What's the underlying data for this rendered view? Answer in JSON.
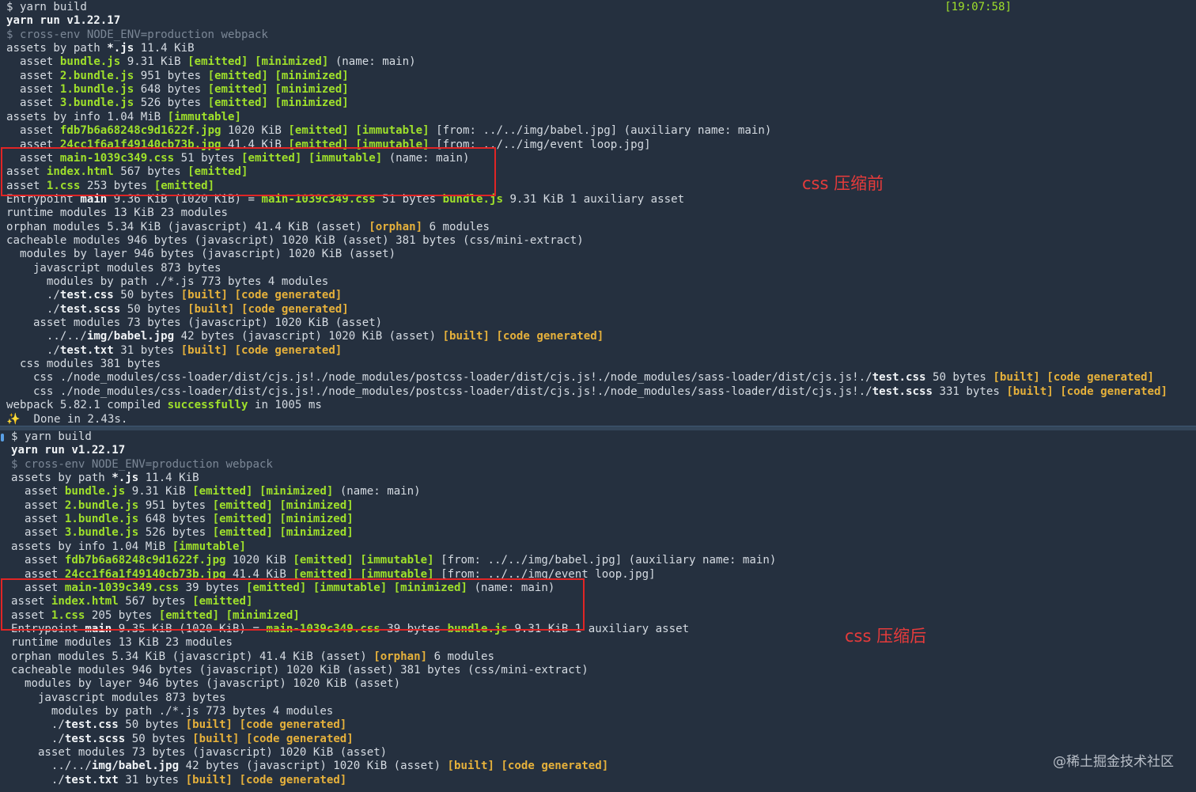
{
  "top": {
    "time": "[19:07:58]",
    "annotation": "css 压缩前",
    "lines": [
      [
        {
          "t": "$ yarn build"
        }
      ],
      [
        {
          "t": "yarn run v1.22.17",
          "s": "b"
        }
      ],
      [
        {
          "t": "$ cross-env NODE_ENV=production webpack",
          "s": "dim"
        }
      ],
      [
        {
          "t": "assets by path "
        },
        {
          "t": "*.js",
          "s": "b"
        },
        {
          "t": " 11.4 KiB"
        }
      ],
      [
        {
          "t": "  asset "
        },
        {
          "t": "bundle.js",
          "s": "g"
        },
        {
          "t": " 9.31 KiB "
        },
        {
          "t": "[emitted] [minimized]",
          "s": "g"
        },
        {
          "t": " (name: main)"
        }
      ],
      [
        {
          "t": "  asset "
        },
        {
          "t": "2.bundle.js",
          "s": "g"
        },
        {
          "t": " 951 bytes "
        },
        {
          "t": "[emitted] [minimized]",
          "s": "g"
        }
      ],
      [
        {
          "t": "  asset "
        },
        {
          "t": "1.bundle.js",
          "s": "g"
        },
        {
          "t": " 648 bytes "
        },
        {
          "t": "[emitted] [minimized]",
          "s": "g"
        }
      ],
      [
        {
          "t": "  asset "
        },
        {
          "t": "3.bundle.js",
          "s": "g"
        },
        {
          "t": " 526 bytes "
        },
        {
          "t": "[emitted] [minimized]",
          "s": "g"
        }
      ],
      [
        {
          "t": "assets by info 1.04 MiB "
        },
        {
          "t": "[immutable]",
          "s": "g"
        }
      ],
      [
        {
          "t": "  asset "
        },
        {
          "t": "fdb7b6a68248c9d1622f.jpg",
          "s": "g"
        },
        {
          "t": " 1020 KiB "
        },
        {
          "t": "[emitted] [immutable]",
          "s": "g"
        },
        {
          "t": " [from: ../../img/babel.jpg] (auxiliary name: main)"
        }
      ],
      [
        {
          "t": "  asset "
        },
        {
          "t": "24cc1f6a1f49140cb73b.jpg",
          "s": "g"
        },
        {
          "t": " 41.4 KiB "
        },
        {
          "t": "[emitted] [immutable]",
          "s": "g"
        },
        {
          "t": " [from: ../../img/event loop.jpg]"
        }
      ],
      [
        {
          "t": "  asset "
        },
        {
          "t": "main-1039c349.css",
          "s": "g"
        },
        {
          "t": " 51 bytes "
        },
        {
          "t": "[emitted] [immutable]",
          "s": "g"
        },
        {
          "t": " (name: main)"
        }
      ],
      [
        {
          "t": "asset "
        },
        {
          "t": "index.html",
          "s": "g"
        },
        {
          "t": " 567 bytes "
        },
        {
          "t": "[emitted]",
          "s": "g"
        }
      ],
      [
        {
          "t": "asset "
        },
        {
          "t": "1.css",
          "s": "g"
        },
        {
          "t": " 253 bytes "
        },
        {
          "t": "[emitted]",
          "s": "g"
        }
      ],
      [
        {
          "t": "Entrypoint "
        },
        {
          "t": "main",
          "s": "b"
        },
        {
          "t": " 9.36 KiB (1020 KiB) = "
        },
        {
          "t": "main-1039c349.css",
          "s": "g"
        },
        {
          "t": " 51 bytes "
        },
        {
          "t": "bundle.js",
          "s": "g"
        },
        {
          "t": " 9.31 KiB 1 auxiliary asset"
        }
      ],
      [
        {
          "t": "runtime modules 13 KiB 23 modules"
        }
      ],
      [
        {
          "t": "orphan modules 5.34 KiB (javascript) 41.4 KiB (asset) "
        },
        {
          "t": "[orphan]",
          "s": "y"
        },
        {
          "t": " 6 modules"
        }
      ],
      [
        {
          "t": "cacheable modules 946 bytes (javascript) 1020 KiB (asset) 381 bytes (css/mini-extract)"
        }
      ],
      [
        {
          "t": "  modules by layer 946 bytes (javascript) 1020 KiB (asset)"
        }
      ],
      [
        {
          "t": "    javascript modules 873 bytes"
        }
      ],
      [
        {
          "t": "      modules by path ./*.js 773 bytes 4 modules"
        }
      ],
      [
        {
          "t": "      ./"
        },
        {
          "t": "test.css",
          "s": "b"
        },
        {
          "t": " 50 bytes "
        },
        {
          "t": "[built] [code generated]",
          "s": "y"
        }
      ],
      [
        {
          "t": "      ./"
        },
        {
          "t": "test.scss",
          "s": "b"
        },
        {
          "t": " 50 bytes "
        },
        {
          "t": "[built] [code generated]",
          "s": "y"
        }
      ],
      [
        {
          "t": "    asset modules 73 bytes (javascript) 1020 KiB (asset)"
        }
      ],
      [
        {
          "t": "      ../../"
        },
        {
          "t": "img/babel.jpg",
          "s": "b"
        },
        {
          "t": " 42 bytes (javascript) 1020 KiB (asset) "
        },
        {
          "t": "[built] [code generated]",
          "s": "y"
        }
      ],
      [
        {
          "t": "      ./"
        },
        {
          "t": "test.txt",
          "s": "b"
        },
        {
          "t": " 31 bytes "
        },
        {
          "t": "[built] [code generated]",
          "s": "y"
        }
      ],
      [
        {
          "t": "  css modules 381 bytes"
        }
      ],
      [
        {
          "t": "    css ./node_modules/css-loader/dist/cjs.js!./node_modules/postcss-loader/dist/cjs.js!./node_modules/sass-loader/dist/cjs.js!./"
        },
        {
          "t": "test.css",
          "s": "b"
        },
        {
          "t": " 50 bytes "
        },
        {
          "t": "[built] [code generated]",
          "s": "y"
        }
      ],
      [
        {
          "t": "    css ./node_modules/css-loader/dist/cjs.js!./node_modules/postcss-loader/dist/cjs.js!./node_modules/sass-loader/dist/cjs.js!./"
        },
        {
          "t": "test.scss",
          "s": "b"
        },
        {
          "t": " 331 bytes "
        },
        {
          "t": "[built] [code generated]",
          "s": "y"
        }
      ],
      [
        {
          "t": "webpack 5.82.1 compiled "
        },
        {
          "t": "successfully",
          "s": "g"
        },
        {
          "t": " in 1005 ms"
        }
      ],
      [
        {
          "t": "✨",
          "s": "spark"
        },
        {
          "t": "  Done in 2.43s."
        }
      ]
    ]
  },
  "bottom": {
    "annotation": "css 压缩后",
    "lines": [
      [
        {
          "t": "$ yarn build"
        }
      ],
      [
        {
          "t": "yarn run v1.22.17",
          "s": "b"
        }
      ],
      [
        {
          "t": "$ cross-env NODE_ENV=production webpack",
          "s": "dim"
        }
      ],
      [
        {
          "t": "assets by path "
        },
        {
          "t": "*.js",
          "s": "b"
        },
        {
          "t": " 11.4 KiB"
        }
      ],
      [
        {
          "t": "  asset "
        },
        {
          "t": "bundle.js",
          "s": "g"
        },
        {
          "t": " 9.31 KiB "
        },
        {
          "t": "[emitted] [minimized]",
          "s": "g"
        },
        {
          "t": " (name: main)"
        }
      ],
      [
        {
          "t": "  asset "
        },
        {
          "t": "2.bundle.js",
          "s": "g"
        },
        {
          "t": " 951 bytes "
        },
        {
          "t": "[emitted] [minimized]",
          "s": "g"
        }
      ],
      [
        {
          "t": "  asset "
        },
        {
          "t": "1.bundle.js",
          "s": "g"
        },
        {
          "t": " 648 bytes "
        },
        {
          "t": "[emitted] [minimized]",
          "s": "g"
        }
      ],
      [
        {
          "t": "  asset "
        },
        {
          "t": "3.bundle.js",
          "s": "g"
        },
        {
          "t": " 526 bytes "
        },
        {
          "t": "[emitted] [minimized]",
          "s": "g"
        }
      ],
      [
        {
          "t": "assets by info 1.04 MiB "
        },
        {
          "t": "[immutable]",
          "s": "g"
        }
      ],
      [
        {
          "t": "  asset "
        },
        {
          "t": "fdb7b6a68248c9d1622f.jpg",
          "s": "g"
        },
        {
          "t": " 1020 KiB "
        },
        {
          "t": "[emitted] [immutable]",
          "s": "g"
        },
        {
          "t": " [from: ../../img/babel.jpg] (auxiliary name: main)"
        }
      ],
      [
        {
          "t": "  asset "
        },
        {
          "t": "24cc1f6a1f49140cb73b.jpg",
          "s": "g"
        },
        {
          "t": " 41.4 KiB "
        },
        {
          "t": "[emitted] [immutable]",
          "s": "g"
        },
        {
          "t": " [from: ../../img/event loop.jpg]"
        }
      ],
      [
        {
          "t": "  asset "
        },
        {
          "t": "main-1039c349.css",
          "s": "g"
        },
        {
          "t": " 39 bytes "
        },
        {
          "t": "[emitted] [immutable] [minimized]",
          "s": "g"
        },
        {
          "t": " (name: main)"
        }
      ],
      [
        {
          "t": "asset "
        },
        {
          "t": "index.html",
          "s": "g"
        },
        {
          "t": " 567 bytes "
        },
        {
          "t": "[emitted]",
          "s": "g"
        }
      ],
      [
        {
          "t": "asset "
        },
        {
          "t": "1.css",
          "s": "g"
        },
        {
          "t": " 205 bytes "
        },
        {
          "t": "[emitted] [minimized]",
          "s": "g"
        }
      ],
      [
        {
          "t": "Entrypoint "
        },
        {
          "t": "main",
          "s": "b"
        },
        {
          "t": " 9.35 KiB (1020 KiB) = "
        },
        {
          "t": "main-1039c349.css",
          "s": "g"
        },
        {
          "t": " 39 bytes "
        },
        {
          "t": "bundle.js",
          "s": "g"
        },
        {
          "t": " 9.31 KiB 1 auxiliary asset"
        }
      ],
      [
        {
          "t": "runtime modules 13 KiB 23 modules"
        }
      ],
      [
        {
          "t": "orphan modules 5.34 KiB (javascript) 41.4 KiB (asset) "
        },
        {
          "t": "[orphan]",
          "s": "y"
        },
        {
          "t": " 6 modules"
        }
      ],
      [
        {
          "t": "cacheable modules 946 bytes (javascript) 1020 KiB (asset) 381 bytes (css/mini-extract)"
        }
      ],
      [
        {
          "t": "  modules by layer 946 bytes (javascript) 1020 KiB (asset)"
        }
      ],
      [
        {
          "t": "    javascript modules 873 bytes"
        }
      ],
      [
        {
          "t": "      modules by path ./*.js 773 bytes 4 modules"
        }
      ],
      [
        {
          "t": "      ./"
        },
        {
          "t": "test.css",
          "s": "b"
        },
        {
          "t": " 50 bytes "
        },
        {
          "t": "[built] [code generated]",
          "s": "y"
        }
      ],
      [
        {
          "t": "      ./"
        },
        {
          "t": "test.scss",
          "s": "b"
        },
        {
          "t": " 50 bytes "
        },
        {
          "t": "[built] [code generated]",
          "s": "y"
        }
      ],
      [
        {
          "t": "    asset modules 73 bytes (javascript) 1020 KiB (asset)"
        }
      ],
      [
        {
          "t": "      ../../"
        },
        {
          "t": "img/babel.jpg",
          "s": "b"
        },
        {
          "t": " 42 bytes (javascript) 1020 KiB (asset) "
        },
        {
          "t": "[built] [code generated]",
          "s": "y"
        }
      ],
      [
        {
          "t": "      ./"
        },
        {
          "t": "test.txt",
          "s": "b"
        },
        {
          "t": " 31 bytes "
        },
        {
          "t": "[built] [code generated]",
          "s": "y"
        }
      ]
    ]
  },
  "watermark": "@稀土掘金技术社区"
}
